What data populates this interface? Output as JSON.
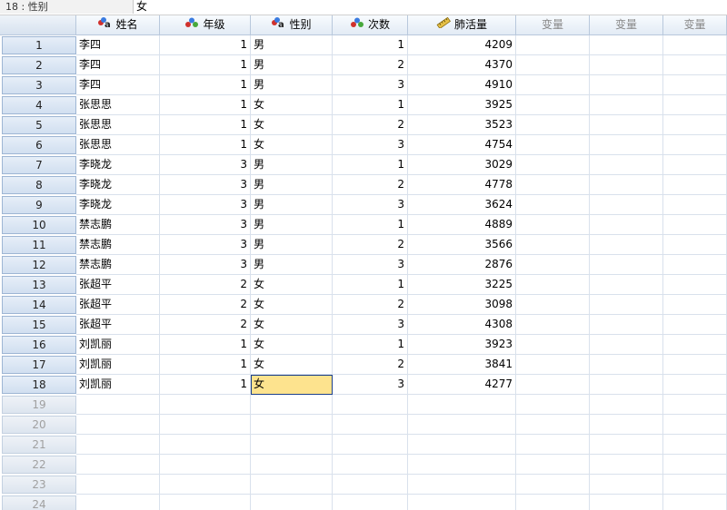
{
  "cell_editor": {
    "ref": "18 : 性别",
    "value": "女"
  },
  "columns": [
    {
      "label": "姓名",
      "icon": "nominal-string-icon"
    },
    {
      "label": "年级",
      "icon": "nominal-icon"
    },
    {
      "label": "性别",
      "icon": "nominal-string-icon"
    },
    {
      "label": "次数",
      "icon": "nominal-icon"
    },
    {
      "label": "肺活量",
      "icon": "scale-ruler-icon"
    },
    {
      "label": "变量",
      "icon": ""
    },
    {
      "label": "变量",
      "icon": ""
    },
    {
      "label": "变量",
      "icon": ""
    }
  ],
  "rows": [
    [
      "1",
      "李四",
      "1",
      "男",
      "1",
      "4209"
    ],
    [
      "2",
      "李四",
      "1",
      "男",
      "2",
      "4370"
    ],
    [
      "3",
      "李四",
      "1",
      "男",
      "3",
      "4910"
    ],
    [
      "4",
      "张思思",
      "1",
      "女",
      "1",
      "3925"
    ],
    [
      "5",
      "张思思",
      "1",
      "女",
      "2",
      "3523"
    ],
    [
      "6",
      "张思思",
      "1",
      "女",
      "3",
      "4754"
    ],
    [
      "7",
      "李晓龙",
      "3",
      "男",
      "1",
      "3029"
    ],
    [
      "8",
      "李晓龙",
      "3",
      "男",
      "2",
      "4778"
    ],
    [
      "9",
      "李晓龙",
      "3",
      "男",
      "3",
      "3624"
    ],
    [
      "10",
      "禁志鹏",
      "3",
      "男",
      "1",
      "4889"
    ],
    [
      "11",
      "禁志鹏",
      "3",
      "男",
      "2",
      "3566"
    ],
    [
      "12",
      "禁志鹏",
      "3",
      "男",
      "3",
      "2876"
    ],
    [
      "13",
      "张超平",
      "2",
      "女",
      "1",
      "3225"
    ],
    [
      "14",
      "张超平",
      "2",
      "女",
      "2",
      "3098"
    ],
    [
      "15",
      "张超平",
      "2",
      "女",
      "3",
      "4308"
    ],
    [
      "16",
      "刘凯丽",
      "1",
      "女",
      "1",
      "3923"
    ],
    [
      "17",
      "刘凯丽",
      "1",
      "女",
      "2",
      "3841"
    ],
    [
      "18",
      "刘凯丽",
      "1",
      "女",
      "3",
      "4277"
    ]
  ],
  "empty_rows": [
    "19",
    "20",
    "21",
    "22",
    "23",
    "24"
  ],
  "selected_cell": {
    "row": "18",
    "column": "性别"
  },
  "colors": {
    "selection": "#fde38e",
    "header": "#d1dff0"
  }
}
